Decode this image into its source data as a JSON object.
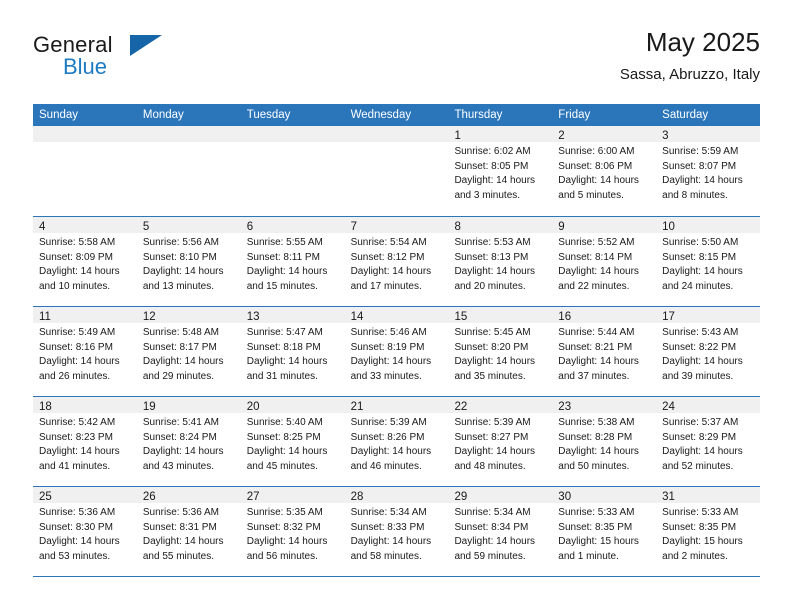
{
  "brand": {
    "name_part1": "General",
    "name_part2": "Blue",
    "triangle_color": "#1565a8",
    "blue_text_color": "#1d7bc4"
  },
  "header": {
    "title": "May 2025",
    "location": "Sassa, Abruzzo, Italy",
    "accent_color": "#2b76bb"
  },
  "weekdays": [
    "Sunday",
    "Monday",
    "Tuesday",
    "Wednesday",
    "Thursday",
    "Friday",
    "Saturday"
  ],
  "weeks": [
    [
      {
        "day": "",
        "sunrise": "",
        "sunset": "",
        "daylight1": "",
        "daylight2": ""
      },
      {
        "day": "",
        "sunrise": "",
        "sunset": "",
        "daylight1": "",
        "daylight2": ""
      },
      {
        "day": "",
        "sunrise": "",
        "sunset": "",
        "daylight1": "",
        "daylight2": ""
      },
      {
        "day": "",
        "sunrise": "",
        "sunset": "",
        "daylight1": "",
        "daylight2": ""
      },
      {
        "day": "1",
        "sunrise": "Sunrise: 6:02 AM",
        "sunset": "Sunset: 8:05 PM",
        "daylight1": "Daylight: 14 hours",
        "daylight2": "and 3 minutes."
      },
      {
        "day": "2",
        "sunrise": "Sunrise: 6:00 AM",
        "sunset": "Sunset: 8:06 PM",
        "daylight1": "Daylight: 14 hours",
        "daylight2": "and 5 minutes."
      },
      {
        "day": "3",
        "sunrise": "Sunrise: 5:59 AM",
        "sunset": "Sunset: 8:07 PM",
        "daylight1": "Daylight: 14 hours",
        "daylight2": "and 8 minutes."
      }
    ],
    [
      {
        "day": "4",
        "sunrise": "Sunrise: 5:58 AM",
        "sunset": "Sunset: 8:09 PM",
        "daylight1": "Daylight: 14 hours",
        "daylight2": "and 10 minutes."
      },
      {
        "day": "5",
        "sunrise": "Sunrise: 5:56 AM",
        "sunset": "Sunset: 8:10 PM",
        "daylight1": "Daylight: 14 hours",
        "daylight2": "and 13 minutes."
      },
      {
        "day": "6",
        "sunrise": "Sunrise: 5:55 AM",
        "sunset": "Sunset: 8:11 PM",
        "daylight1": "Daylight: 14 hours",
        "daylight2": "and 15 minutes."
      },
      {
        "day": "7",
        "sunrise": "Sunrise: 5:54 AM",
        "sunset": "Sunset: 8:12 PM",
        "daylight1": "Daylight: 14 hours",
        "daylight2": "and 17 minutes."
      },
      {
        "day": "8",
        "sunrise": "Sunrise: 5:53 AM",
        "sunset": "Sunset: 8:13 PM",
        "daylight1": "Daylight: 14 hours",
        "daylight2": "and 20 minutes."
      },
      {
        "day": "9",
        "sunrise": "Sunrise: 5:52 AM",
        "sunset": "Sunset: 8:14 PM",
        "daylight1": "Daylight: 14 hours",
        "daylight2": "and 22 minutes."
      },
      {
        "day": "10",
        "sunrise": "Sunrise: 5:50 AM",
        "sunset": "Sunset: 8:15 PM",
        "daylight1": "Daylight: 14 hours",
        "daylight2": "and 24 minutes."
      }
    ],
    [
      {
        "day": "11",
        "sunrise": "Sunrise: 5:49 AM",
        "sunset": "Sunset: 8:16 PM",
        "daylight1": "Daylight: 14 hours",
        "daylight2": "and 26 minutes."
      },
      {
        "day": "12",
        "sunrise": "Sunrise: 5:48 AM",
        "sunset": "Sunset: 8:17 PM",
        "daylight1": "Daylight: 14 hours",
        "daylight2": "and 29 minutes."
      },
      {
        "day": "13",
        "sunrise": "Sunrise: 5:47 AM",
        "sunset": "Sunset: 8:18 PM",
        "daylight1": "Daylight: 14 hours",
        "daylight2": "and 31 minutes."
      },
      {
        "day": "14",
        "sunrise": "Sunrise: 5:46 AM",
        "sunset": "Sunset: 8:19 PM",
        "daylight1": "Daylight: 14 hours",
        "daylight2": "and 33 minutes."
      },
      {
        "day": "15",
        "sunrise": "Sunrise: 5:45 AM",
        "sunset": "Sunset: 8:20 PM",
        "daylight1": "Daylight: 14 hours",
        "daylight2": "and 35 minutes."
      },
      {
        "day": "16",
        "sunrise": "Sunrise: 5:44 AM",
        "sunset": "Sunset: 8:21 PM",
        "daylight1": "Daylight: 14 hours",
        "daylight2": "and 37 minutes."
      },
      {
        "day": "17",
        "sunrise": "Sunrise: 5:43 AM",
        "sunset": "Sunset: 8:22 PM",
        "daylight1": "Daylight: 14 hours",
        "daylight2": "and 39 minutes."
      }
    ],
    [
      {
        "day": "18",
        "sunrise": "Sunrise: 5:42 AM",
        "sunset": "Sunset: 8:23 PM",
        "daylight1": "Daylight: 14 hours",
        "daylight2": "and 41 minutes."
      },
      {
        "day": "19",
        "sunrise": "Sunrise: 5:41 AM",
        "sunset": "Sunset: 8:24 PM",
        "daylight1": "Daylight: 14 hours",
        "daylight2": "and 43 minutes."
      },
      {
        "day": "20",
        "sunrise": "Sunrise: 5:40 AM",
        "sunset": "Sunset: 8:25 PM",
        "daylight1": "Daylight: 14 hours",
        "daylight2": "and 45 minutes."
      },
      {
        "day": "21",
        "sunrise": "Sunrise: 5:39 AM",
        "sunset": "Sunset: 8:26 PM",
        "daylight1": "Daylight: 14 hours",
        "daylight2": "and 46 minutes."
      },
      {
        "day": "22",
        "sunrise": "Sunrise: 5:39 AM",
        "sunset": "Sunset: 8:27 PM",
        "daylight1": "Daylight: 14 hours",
        "daylight2": "and 48 minutes."
      },
      {
        "day": "23",
        "sunrise": "Sunrise: 5:38 AM",
        "sunset": "Sunset: 8:28 PM",
        "daylight1": "Daylight: 14 hours",
        "daylight2": "and 50 minutes."
      },
      {
        "day": "24",
        "sunrise": "Sunrise: 5:37 AM",
        "sunset": "Sunset: 8:29 PM",
        "daylight1": "Daylight: 14 hours",
        "daylight2": "and 52 minutes."
      }
    ],
    [
      {
        "day": "25",
        "sunrise": "Sunrise: 5:36 AM",
        "sunset": "Sunset: 8:30 PM",
        "daylight1": "Daylight: 14 hours",
        "daylight2": "and 53 minutes."
      },
      {
        "day": "26",
        "sunrise": "Sunrise: 5:36 AM",
        "sunset": "Sunset: 8:31 PM",
        "daylight1": "Daylight: 14 hours",
        "daylight2": "and 55 minutes."
      },
      {
        "day": "27",
        "sunrise": "Sunrise: 5:35 AM",
        "sunset": "Sunset: 8:32 PM",
        "daylight1": "Daylight: 14 hours",
        "daylight2": "and 56 minutes."
      },
      {
        "day": "28",
        "sunrise": "Sunrise: 5:34 AM",
        "sunset": "Sunset: 8:33 PM",
        "daylight1": "Daylight: 14 hours",
        "daylight2": "and 58 minutes."
      },
      {
        "day": "29",
        "sunrise": "Sunrise: 5:34 AM",
        "sunset": "Sunset: 8:34 PM",
        "daylight1": "Daylight: 14 hours",
        "daylight2": "and 59 minutes."
      },
      {
        "day": "30",
        "sunrise": "Sunrise: 5:33 AM",
        "sunset": "Sunset: 8:35 PM",
        "daylight1": "Daylight: 15 hours",
        "daylight2": "and 1 minute."
      },
      {
        "day": "31",
        "sunrise": "Sunrise: 5:33 AM",
        "sunset": "Sunset: 8:35 PM",
        "daylight1": "Daylight: 15 hours",
        "daylight2": "and 2 minutes."
      }
    ]
  ]
}
